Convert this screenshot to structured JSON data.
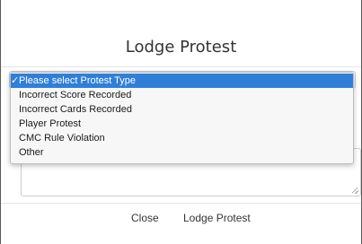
{
  "modal": {
    "title": "Lodge Protest"
  },
  "protest_type_select": {
    "selected": "Please select Protest Type",
    "options": [
      "Please select Protest Type",
      "Incorrect Score Recorded",
      "Incorrect Cards Recorded",
      "Player Protest",
      "CMC Rule Violation",
      "Other"
    ],
    "selected_index": 0,
    "checkmark": "✓"
  },
  "details_textarea": {
    "value": ""
  },
  "footer": {
    "close_label": "Close",
    "lodge_label": "Lodge Protest"
  },
  "colors": {
    "selected_option_bg": "#2f7fd9",
    "text": "#333333"
  }
}
